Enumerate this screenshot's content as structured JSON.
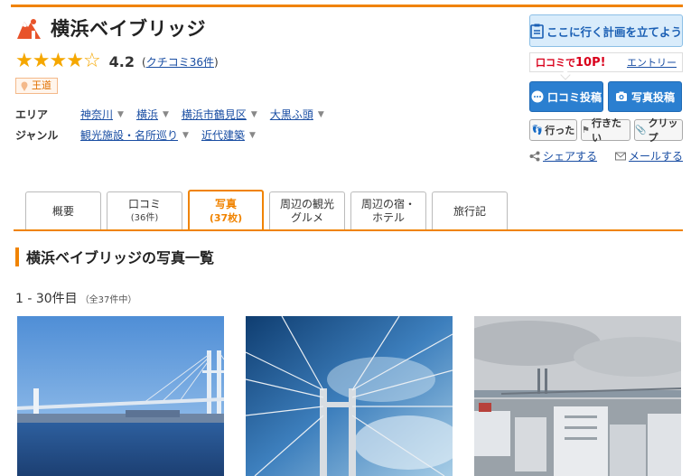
{
  "title": "横浜ベイブリッジ",
  "rating": {
    "stars_filled": 4,
    "stars_total": 5,
    "score": "4.2",
    "review_link": "クチコミ36件"
  },
  "badge": "王道",
  "meta": {
    "area_label": "エリア",
    "area_items": [
      "神奈川",
      "横浜",
      "横浜市鶴見区",
      "大黒ふ頭"
    ],
    "genre_label": "ジャンル",
    "genre_items": [
      "観光施設・名所巡り",
      "近代建築"
    ]
  },
  "actions": {
    "plan": "ここに行く計画を立てよう",
    "points_prefix": "口コミで",
    "points_value": "10P!",
    "entry": "エントリー",
    "post_review": "口コミ投稿",
    "post_photo": "写真投稿",
    "went": "行った",
    "want": "行きたい",
    "clip": "クリップ",
    "share": "シェアする",
    "mail": "メールする"
  },
  "tabs": [
    {
      "label": "概要",
      "sub": ""
    },
    {
      "label": "口コミ",
      "sub": "(36件)"
    },
    {
      "label": "写真",
      "sub": "(37枚)"
    },
    {
      "label": "周辺の観光",
      "sub": "グルメ"
    },
    {
      "label": "周辺の宿・",
      "sub": "ホテル"
    },
    {
      "label": "旅行記",
      "sub": ""
    }
  ],
  "section_title": "横浜ベイブリッジの写真一覧",
  "count_text": "1 - 30件目",
  "count_total": "（全37件中）",
  "colors": {
    "accent": "#f08300",
    "link": "#1a4ea3",
    "star": "#f5a700",
    "primary_button": "#2b7fd0"
  }
}
